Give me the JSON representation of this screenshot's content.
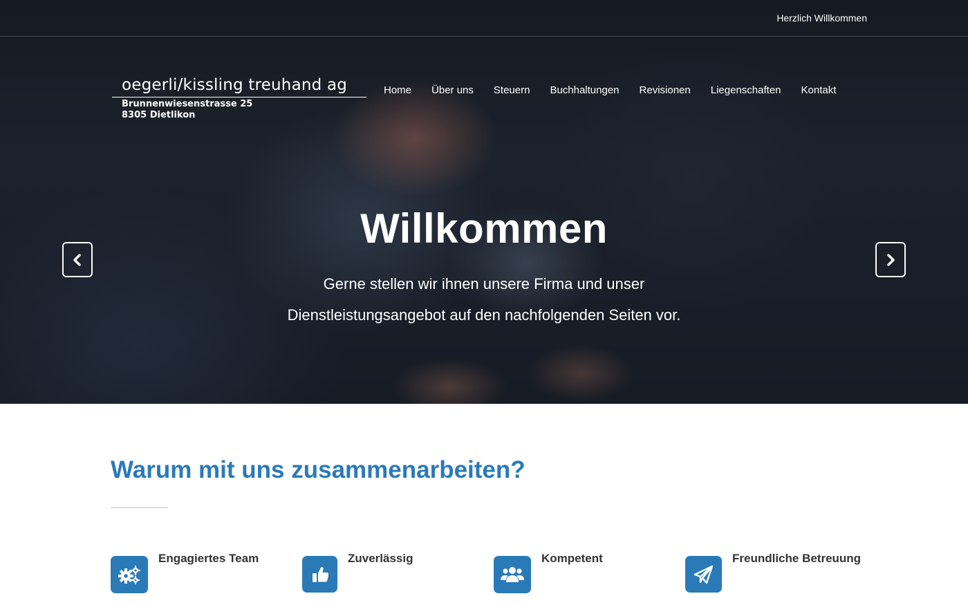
{
  "topbar": {
    "greeting": "Herzlich Willkommen"
  },
  "logo": {
    "name": "oegerli/kissling treuhand ag",
    "address_line1": "Brunnenwiesenstrasse 25",
    "address_line2": "8305 Dietlikon"
  },
  "nav": {
    "items": [
      {
        "label": "Home"
      },
      {
        "label": "Über uns"
      },
      {
        "label": "Steuern"
      },
      {
        "label": "Buchhaltungen"
      },
      {
        "label": "Revisionen"
      },
      {
        "label": "Liegenschaften"
      },
      {
        "label": "Kontakt"
      }
    ]
  },
  "hero": {
    "title": "Willkommen",
    "text_line1": "Gerne stellen wir ihnen unsere Firma und unser",
    "text_line2": "Dienstleistungsangebot auf den nachfolgenden Seiten vor.",
    "prev_icon": "chevron-left-icon",
    "next_icon": "chevron-right-icon"
  },
  "section": {
    "title": "Warum mit uns zusammenarbeiten?",
    "features": [
      {
        "label": "Engagiertes Team",
        "icon": "gears-icon"
      },
      {
        "label": "Zuverlässig",
        "icon": "thumbs-up-icon"
      },
      {
        "label": "Kompetent",
        "icon": "users-icon"
      },
      {
        "label": "Freundliche Betreuung",
        "icon": "paper-plane-icon"
      }
    ]
  },
  "colors": {
    "accent": "#2a7ab8",
    "hero_dark": "#161a22"
  }
}
